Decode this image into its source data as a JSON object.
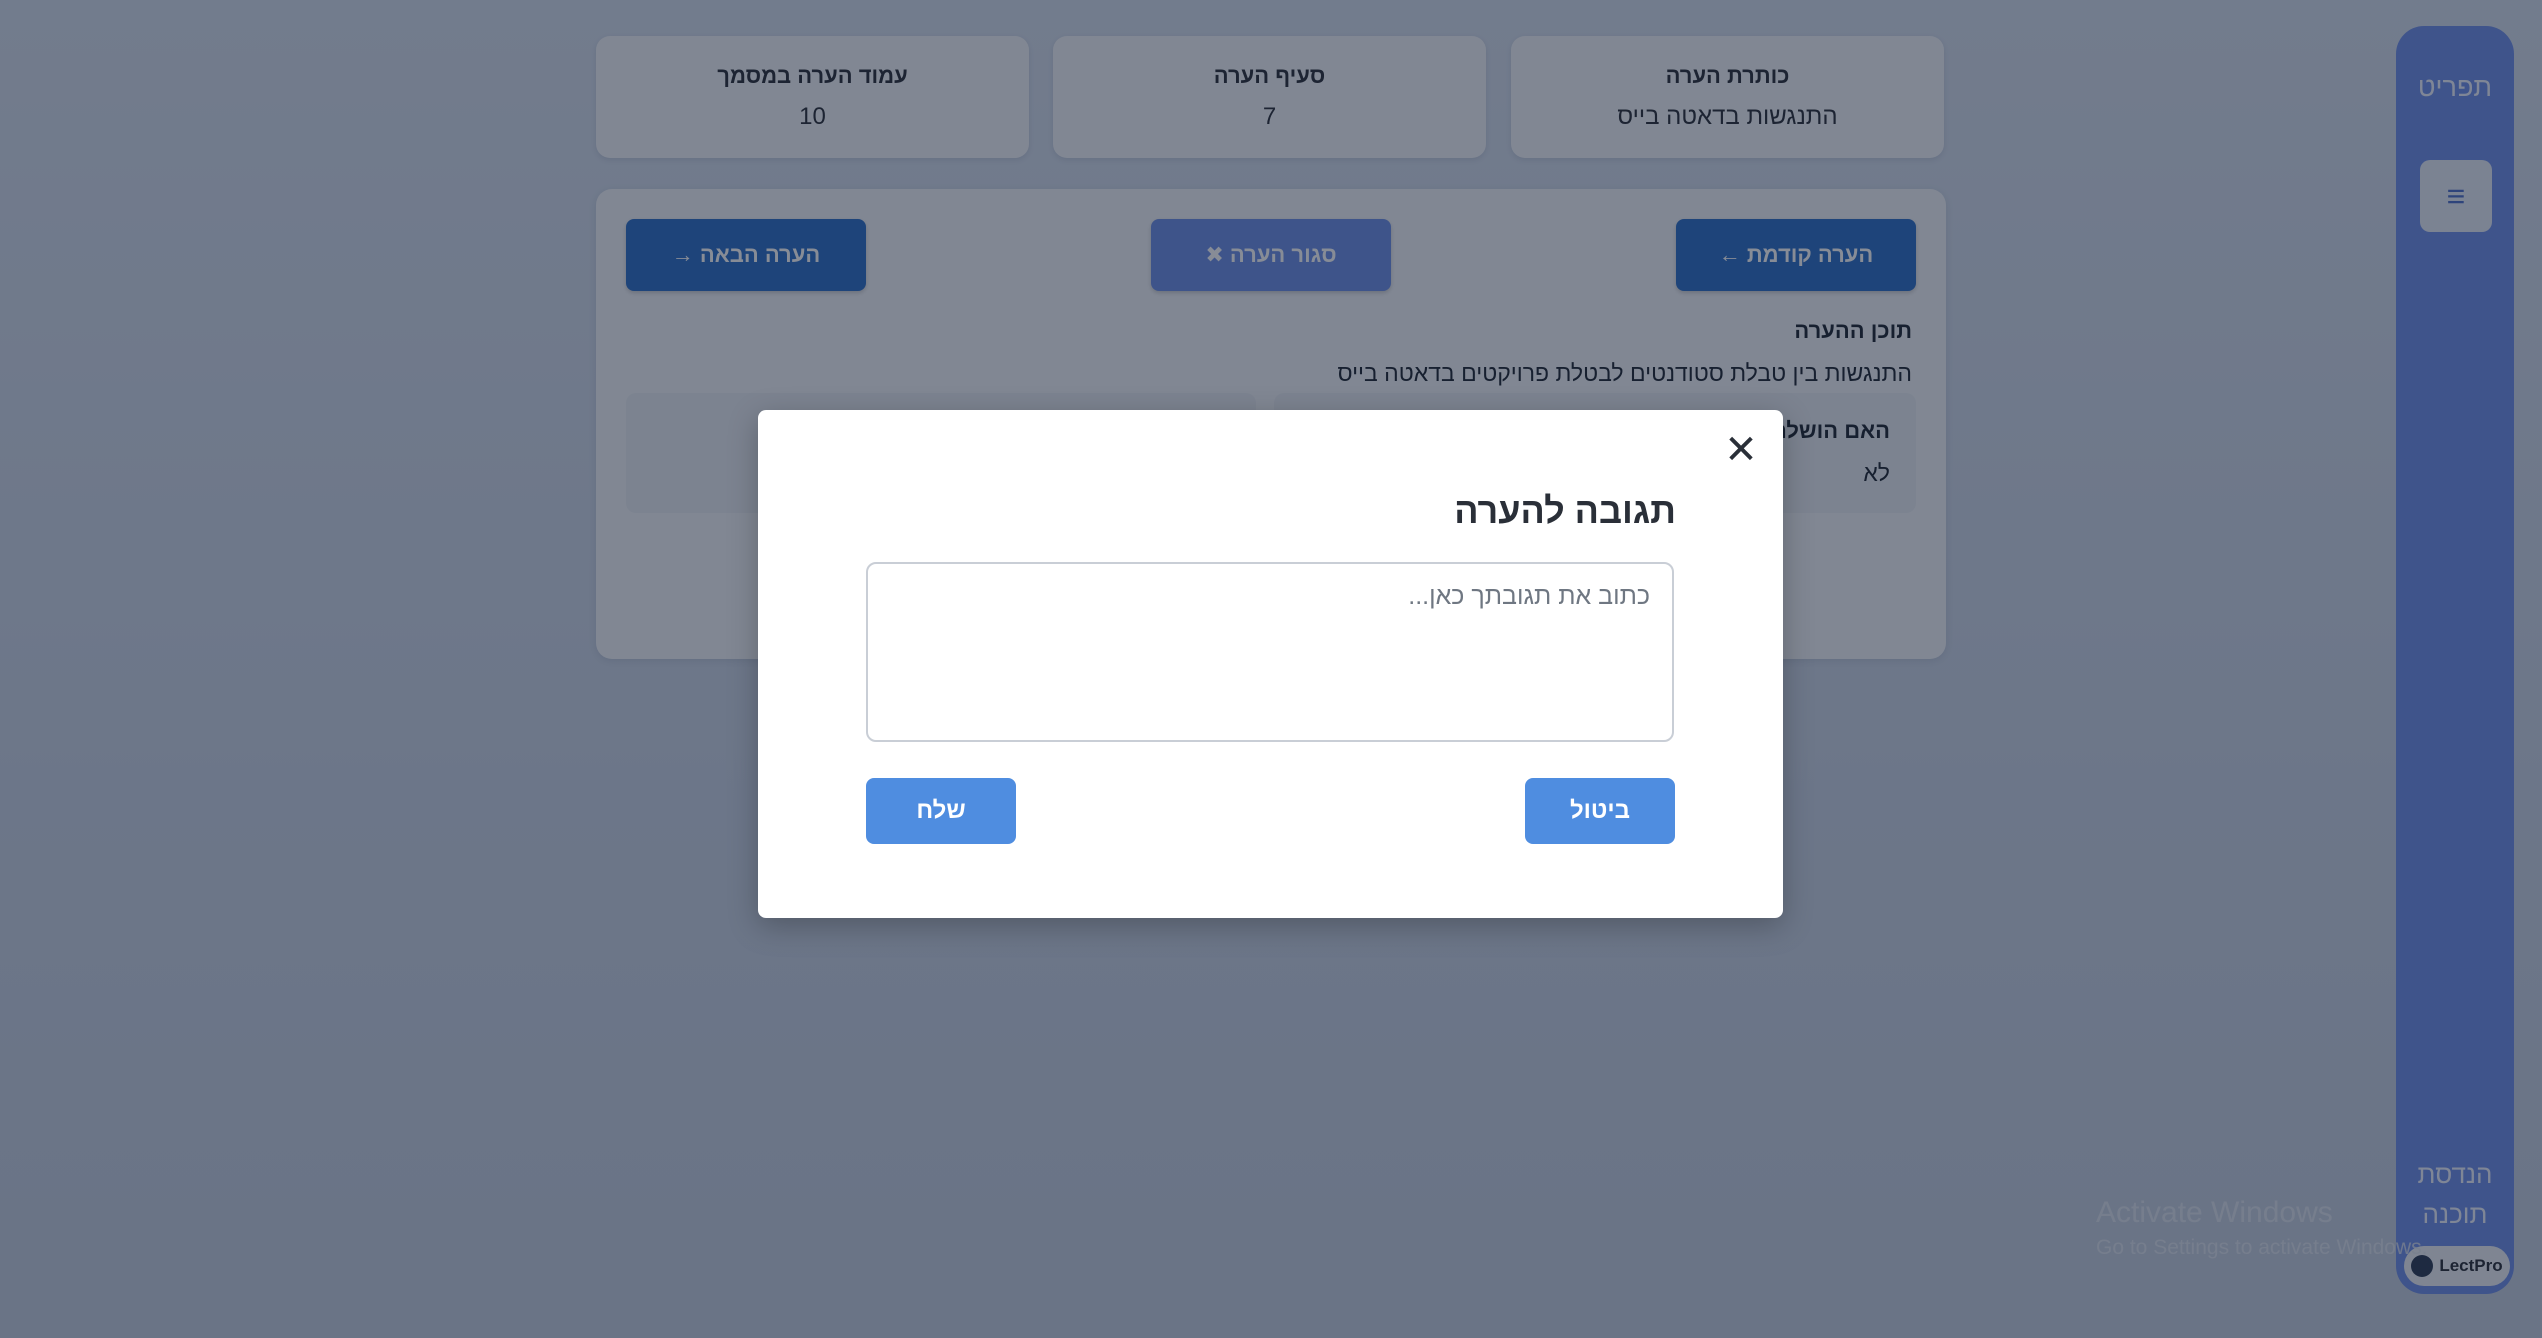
{
  "app": {
    "brand": "תפריט",
    "footer": "הנדסת תוכנה"
  },
  "info_cards": [
    {
      "title": "עמוד הערה במסמך",
      "value": "10"
    },
    {
      "title": "סעיף הערה",
      "value": "7"
    },
    {
      "title": "כותרת הערה",
      "value": "התנגשות בדאטה בייס"
    }
  ],
  "nav": {
    "next": "הערה הבאה →",
    "close": "סגור הערה ✖",
    "prev": "הערה קודמת ←"
  },
  "content": {
    "label": "תוכן ההערה",
    "text": "התנגשות בין טבלת סטודנטים לבטלת פרויקטים בדאטה בייס",
    "status_label": "האם הושלם",
    "status_value": "לא"
  },
  "modal": {
    "title": "תגובה להערה",
    "placeholder": "כתוב את תגובתך כאן...",
    "cancel": "ביטול",
    "send": "שלח",
    "close_symbol": "✕"
  },
  "menu_symbol": "≡",
  "lectpro": "LectPro",
  "watermark": {
    "line1": "Activate Windows",
    "line2": "Go to Settings to activate Windows."
  }
}
